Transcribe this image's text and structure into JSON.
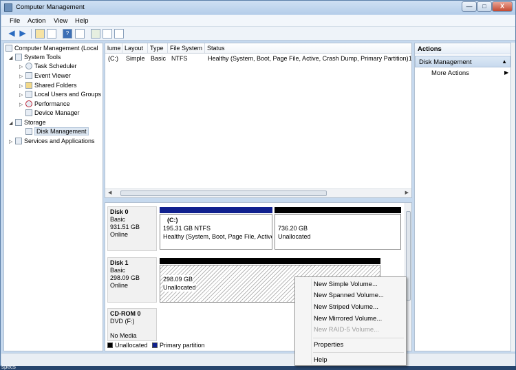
{
  "window": {
    "title": "Computer Management",
    "buttons": {
      "minimize": "—",
      "maximize": "□",
      "close": "X"
    }
  },
  "menu": [
    "File",
    "Action",
    "View",
    "Help"
  ],
  "toolbar": {
    "icons": [
      "back-arrow-icon",
      "forward-arrow-icon",
      "up-folder-icon",
      "show-hide-tree-icon",
      "help-icon",
      "refresh-icon",
      "properties-icon",
      "disk-icon"
    ]
  },
  "tree": {
    "root": "Computer Management (Local",
    "system_tools": "System Tools",
    "task_scheduler": "Task Scheduler",
    "event_viewer": "Event Viewer",
    "shared_folders": "Shared Folders",
    "local_users": "Local Users and Groups",
    "performance": "Performance",
    "device_manager": "Device Manager",
    "storage": "Storage",
    "disk_management": "Disk Management",
    "services": "Services and Applications"
  },
  "volume_list": {
    "headers": [
      "lume",
      "Layout",
      "Type",
      "File System",
      "Status"
    ],
    "row": {
      "volume": "(C:)",
      "layout": "Simple",
      "type": "Basic",
      "fs": "NTFS",
      "status": "Healthy (System, Boot, Page File, Active, Crash Dump, Primary Partition)",
      "overflow": "1"
    }
  },
  "disks": {
    "disk0": {
      "name": "Disk 0",
      "type": "Basic",
      "size": "931.51 GB",
      "state": "Online",
      "p1": {
        "label": "(C:)",
        "size": "195.31 GB NTFS",
        "status": "Healthy (System, Boot, Page File, Active"
      },
      "p2": {
        "size": "736.20 GB",
        "status": "Unallocated"
      }
    },
    "disk1": {
      "name": "Disk 1",
      "type": "Basic",
      "size": "298.09 GB",
      "state": "Online",
      "p1": {
        "size": "298.09 GB",
        "status": "Unallocated"
      }
    },
    "cdrom": {
      "name": "CD-ROM 0",
      "type": "DVD (F:)",
      "state": "No Media"
    }
  },
  "legend": {
    "unallocated": "Unallocated",
    "primary": "Primary partition"
  },
  "colors": {
    "primary": "#10208e",
    "unallocated": "#000000"
  },
  "actions": {
    "title": "Actions",
    "section": "Disk Management",
    "more": "More Actions"
  },
  "context_menu": {
    "simple": "New Simple Volume...",
    "spanned": "New Spanned Volume...",
    "striped": "New Striped Volume...",
    "mirrored": "New Mirrored Volume...",
    "raid5": "New RAID-5 Volume...",
    "properties": "Properties",
    "help": "Help"
  },
  "taskbar": {
    "text": "specs"
  }
}
